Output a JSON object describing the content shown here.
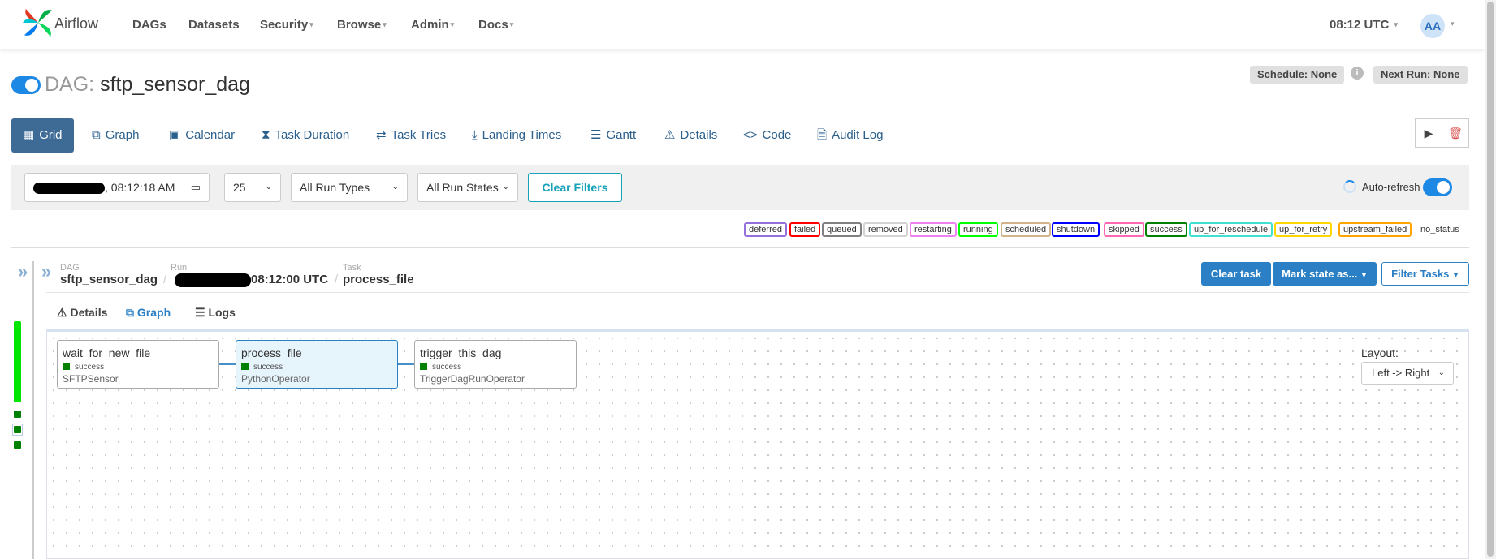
{
  "nav": {
    "brand": "Airflow",
    "items": [
      "DAGs",
      "Datasets",
      "Security",
      "Browse",
      "Admin",
      "Docs"
    ],
    "clock": "08:12 UTC",
    "avatar": "AA"
  },
  "dag": {
    "prefix": "DAG:",
    "name": "sftp_sensor_dag",
    "enabled": true,
    "schedule": "Schedule: None",
    "next_run": "Next Run: None"
  },
  "tabs": [
    "Grid",
    "Graph",
    "Calendar",
    "Task Duration",
    "Task Tries",
    "Landing Times",
    "Gantt",
    "Details",
    "Code",
    "Audit Log"
  ],
  "filters": {
    "datetime_time": ", 08:12:18 AM",
    "num_runs": "25",
    "run_types": "All Run Types",
    "run_states": "All Run States",
    "clear": "Clear Filters",
    "auto_refresh": "Auto-refresh"
  },
  "legend": [
    {
      "label": "deferred",
      "color": "#9370db"
    },
    {
      "label": "failed",
      "color": "#ff0000"
    },
    {
      "label": "queued",
      "color": "#808080"
    },
    {
      "label": "removed",
      "color": "#d3d3d3"
    },
    {
      "label": "restarting",
      "color": "#ee82ee"
    },
    {
      "label": "running",
      "color": "#00ff00"
    },
    {
      "label": "scheduled",
      "color": "#d2b48c"
    },
    {
      "label": "shutdown",
      "color": "#0000ff"
    },
    {
      "label": "skipped",
      "color": "#ff69b4"
    },
    {
      "label": "success",
      "color": "#008000"
    },
    {
      "label": "up_for_reschedule",
      "color": "#40e0d0"
    },
    {
      "label": "up_for_retry",
      "color": "#ffd700"
    },
    {
      "label": "upstream_failed",
      "color": "#ffa500"
    },
    {
      "label": "no_status",
      "color": "#ffffff"
    }
  ],
  "breadcrumb": {
    "dag_label": "DAG",
    "dag": "sftp_sensor_dag",
    "run_label": "Run",
    "run_time": "08:12:00 UTC",
    "task_label": "Task",
    "task": "process_file"
  },
  "actions": {
    "clear_task": "Clear task",
    "mark_state": "Mark state as...",
    "filter_tasks": "Filter Tasks"
  },
  "subtabs": [
    "Details",
    "Graph",
    "Logs"
  ],
  "nodes": [
    {
      "name": "wait_for_new_file",
      "state": "success",
      "operator": "SFTPSensor"
    },
    {
      "name": "process_file",
      "state": "success",
      "operator": "PythonOperator"
    },
    {
      "name": "trigger_this_dag",
      "state": "success",
      "operator": "TriggerDagRunOperator"
    }
  ],
  "layout": {
    "label": "Layout:",
    "value": "Left -> Right"
  }
}
